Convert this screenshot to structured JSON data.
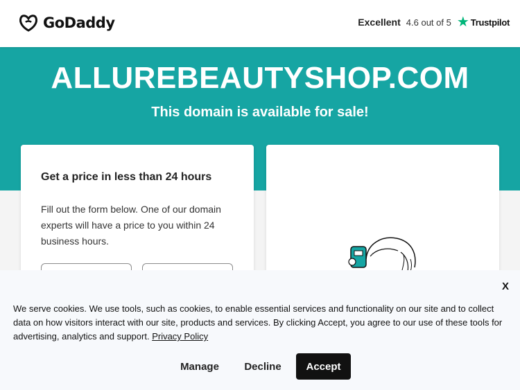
{
  "header": {
    "brand": "GoDaddy",
    "rating_word": "Excellent",
    "rating_score": "4.6 out of 5",
    "trustpilot_label": "Trustpilot"
  },
  "hero": {
    "domain": "ALLUREBEAUTYSHOP.COM",
    "subtitle": "This domain is available for sale!"
  },
  "price_card": {
    "heading": "Get a price in less than 24 hours",
    "body": "Fill out the form below. One of our domain experts will have a price to you within 24 business hours."
  },
  "cookie_banner": {
    "close_label": "X",
    "text": "We serve cookies. We use tools, such as cookies, to enable essential services and functionality on our site and to collect data on how visitors interact with our site, products and services. By clicking Accept, you agree to our use of these tools for advertising, analytics and support.",
    "privacy_link": "Privacy Policy",
    "manage_label": "Manage",
    "decline_label": "Decline",
    "accept_label": "Accept"
  },
  "colors": {
    "hero_bg": "#16a5a3",
    "trustpilot_green": "#00b67a",
    "accept_bg": "#111111"
  },
  "icons": {
    "logo": "godaddy-logo-icon",
    "trustpilot": "trustpilot-star-icon"
  }
}
